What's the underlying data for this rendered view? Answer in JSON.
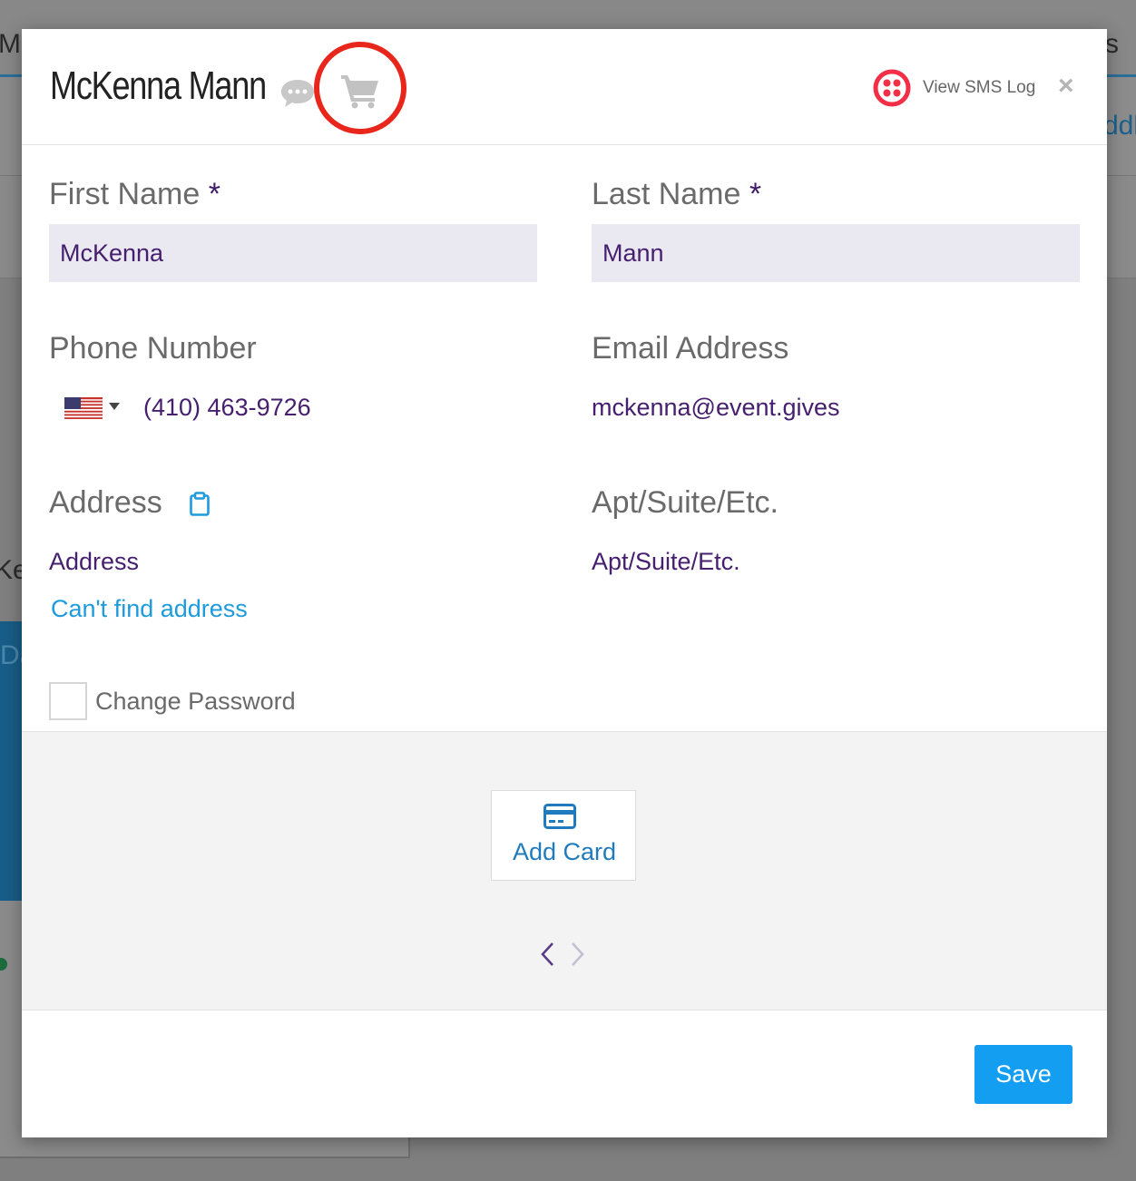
{
  "background": {
    "fragments": [
      "Mc",
      "s",
      "ddle",
      "Ken",
      "Da"
    ]
  },
  "modal": {
    "title": "McKenna Mann",
    "header_icons": {
      "chat": "chat-bubble-icon",
      "cart": "shopping-cart-icon",
      "twilio": "twilio-icon",
      "close": "×"
    },
    "sms_link": "View SMS Log"
  },
  "form": {
    "first_name": {
      "label": "First Name",
      "required_mark": "*",
      "value": "McKenna"
    },
    "last_name": {
      "label": "Last Name",
      "required_mark": "*",
      "value": "Mann"
    },
    "phone": {
      "label": "Phone Number",
      "country_flag": "us-flag-icon",
      "value": "(410) 463-9726"
    },
    "email": {
      "label": "Email Address",
      "value": "mckenna@event.gives"
    },
    "address": {
      "label": "Address",
      "placeholder": "Address",
      "cant_find_link": "Can't find address",
      "icon": "clipboard-icon"
    },
    "apt": {
      "label": "Apt/Suite/Etc.",
      "placeholder": "Apt/Suite/Etc."
    },
    "change_password": {
      "label": "Change Password"
    }
  },
  "cards": {
    "add_card_label": "Add Card",
    "icon": "credit-card-icon"
  },
  "footer": {
    "save_label": "Save"
  },
  "colors": {
    "accent": "#149ef2",
    "text_purple": "#46206f",
    "link_blue": "#1d9bdc",
    "highlight": "#e8261c",
    "twilio_red": "#f22f46"
  }
}
